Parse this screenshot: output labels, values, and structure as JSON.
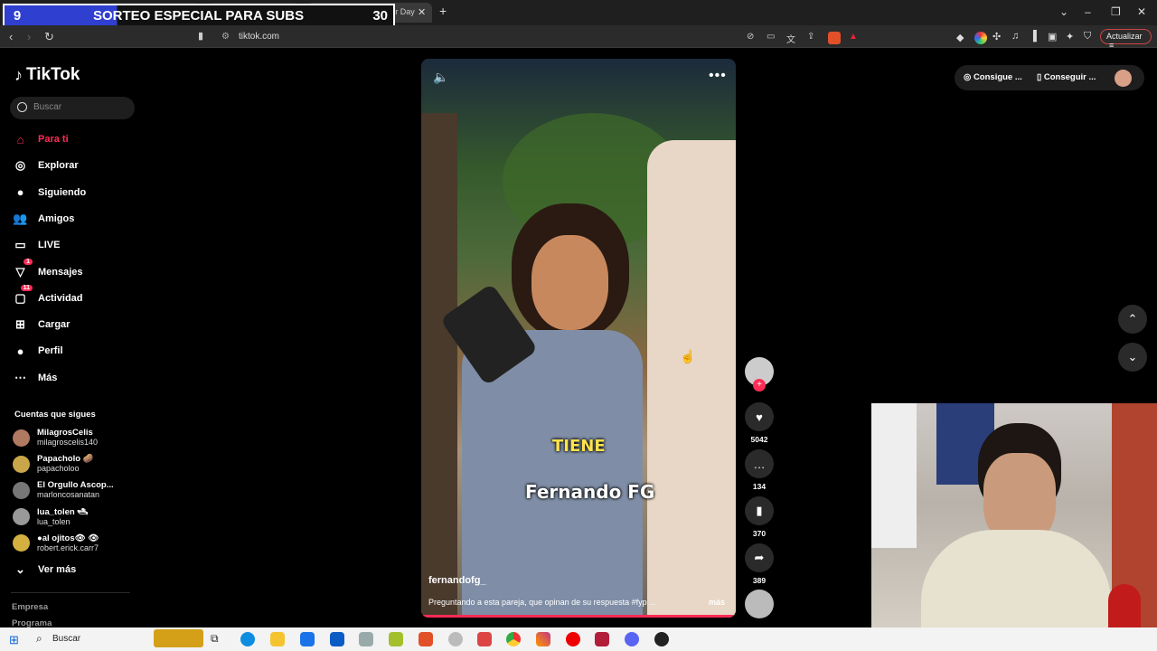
{
  "overlay": {
    "number": "9",
    "title": "SORTEO ESPECIAL PARA SUBS",
    "count": "30"
  },
  "browser": {
    "active_tab": "(12)TikTok - Make Your Day",
    "url": "tiktok.com",
    "update_label": "Actualizar",
    "add_tab": "+"
  },
  "tiktok": {
    "logo": "TikTok",
    "search_placeholder": "Buscar",
    "nav": [
      {
        "label": "Para ti",
        "icon": "home-icon",
        "active": true
      },
      {
        "label": "Explorar",
        "icon": "compass-icon"
      },
      {
        "label": "Siguiendo",
        "icon": "following-icon"
      },
      {
        "label": "Amigos",
        "icon": "friends-icon"
      },
      {
        "label": "LIVE",
        "icon": "live-icon"
      },
      {
        "label": "Mensajes",
        "icon": "messages-icon",
        "badge": "1"
      },
      {
        "label": "Actividad",
        "icon": "activity-icon",
        "badge": "11"
      },
      {
        "label": "Cargar",
        "icon": "upload-icon"
      },
      {
        "label": "Perfil",
        "icon": "profile-avatar-icon"
      },
      {
        "label": "Más",
        "icon": "more-dots-icon"
      }
    ],
    "following_heading": "Cuentas que sigues",
    "following": [
      {
        "name": "MilagrosCelis",
        "handle": "milagroscelis140"
      },
      {
        "name": "Papacholo 🥔",
        "handle": "papacholoo"
      },
      {
        "name": "El Orgullo Ascop...",
        "handle": "marloncosanatan"
      },
      {
        "name": "lua_tolen 🛥",
        "handle": "lua_tolen"
      },
      {
        "name": "●al ojitos👁 👁",
        "handle": "robert.erick.carr7"
      }
    ],
    "see_more": "Ver más",
    "footer": [
      "Empresa",
      "Programa"
    ],
    "top_right": {
      "coins": "Consigue ...",
      "app": "Conseguir ..."
    },
    "video": {
      "caption_word": "TIENE",
      "caption_name": "Fernando FG",
      "author": "fernandofg_",
      "description": "Preguntando a esta pareja, que opinan de su respuesta #fyp ...",
      "more": "más",
      "likes": "5042",
      "comments": "134",
      "saves": "370",
      "shares": "389"
    }
  },
  "taskbar": {
    "search": "Buscar"
  },
  "colors": {
    "accent": "#fe2c55",
    "banner": "#2f3fd0"
  }
}
